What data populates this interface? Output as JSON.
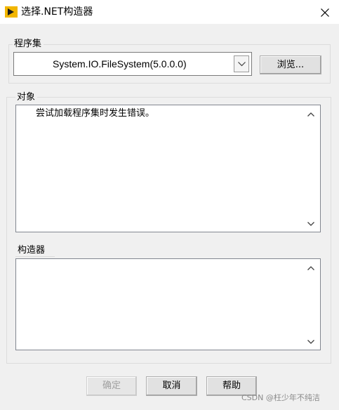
{
  "window": {
    "title": "选择.NET构造器",
    "icon": "labview-arrow-icon",
    "accent_color": "#f2b600"
  },
  "assembly": {
    "label": "程序集",
    "selected_value": "System.IO.FileSystem(5.0.0.0)",
    "browse_label": "浏览..."
  },
  "objects": {
    "label": "对象",
    "items": [
      "尝试加载程序集时发生错误。"
    ]
  },
  "constructors": {
    "label": "构造器",
    "items": []
  },
  "footer": {
    "ok_label": "确定",
    "cancel_label": "取消",
    "help_label": "帮助"
  },
  "watermark": "CSDN @枉少年不纯洁"
}
